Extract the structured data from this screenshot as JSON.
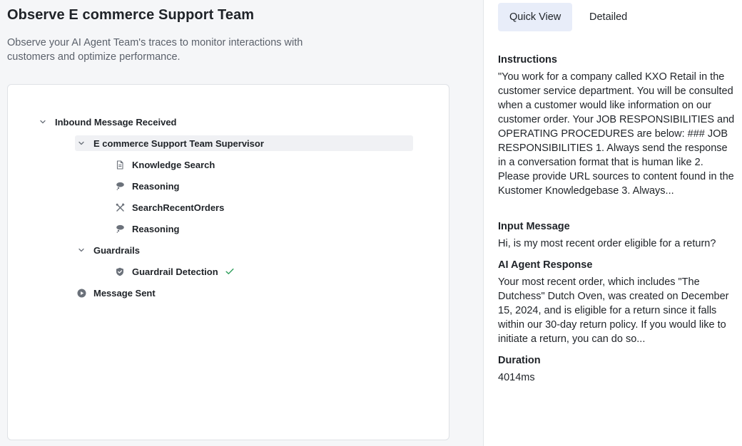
{
  "header": {
    "title": "Observe E commerce Support Team",
    "subtitle": "Observe your AI Agent Team's traces to monitor interactions with customers and optimize performance."
  },
  "trace_tree": {
    "root": {
      "label": "Inbound Message Received",
      "expanded": true,
      "icon": "chevron-down-icon"
    },
    "supervisor": {
      "label": "E commerce Support Team Supervisor",
      "expanded": true,
      "selected": true,
      "icon": "chevron-down-icon",
      "children": [
        {
          "label": "Knowledge Search",
          "icon": "document-icon"
        },
        {
          "label": "Reasoning",
          "icon": "thought-bubble-icon"
        },
        {
          "label": "SearchRecentOrders",
          "icon": "tools-icon"
        },
        {
          "label": "Reasoning",
          "icon": "thought-bubble-icon"
        }
      ]
    },
    "guardrails": {
      "label": "Guardrails",
      "expanded": true,
      "icon": "chevron-down-icon",
      "children": [
        {
          "label": "Guardrail Detection",
          "icon": "shield-icon",
          "status": "passed",
          "status_icon": "check-icon"
        }
      ]
    },
    "message_sent": {
      "label": "Message Sent",
      "icon": "play-circle-icon"
    }
  },
  "details_panel": {
    "tabs": [
      {
        "label": "Quick View",
        "active": true
      },
      {
        "label": "Detailed",
        "active": false
      }
    ],
    "instructions_label": "Instructions",
    "instructions_text": "\"You work for a company called KXO Retail in the customer service department. You will be consulted when a customer would like information on our customer order. Your JOB RESPONSIBILITIES and OPERATING PROCEDURES are below: ### JOB RESPONSIBILITIES 1. Always send the response in a conversation format that is human like 2. Please provide URL sources to content found in the Kustomer Knowledgebase 3. Always...",
    "input_label": "Input Message",
    "input_text": "Hi, is my most recent order eligible for a return?",
    "response_label": "AI Agent Response",
    "response_text": "Your most recent order, which includes \"The Dutchess\" Dutch Oven, was created on December 15, 2024, and is eligible for a return since it falls within our 30-day return policy. If you would like to initiate a return, you can do so...",
    "duration_label": "Duration",
    "duration_value": "4014ms"
  },
  "colors": {
    "accent_tab_bg": "#e8edf9",
    "check_green": "#2e9e5b",
    "left_bg": "#f5f6f8"
  }
}
